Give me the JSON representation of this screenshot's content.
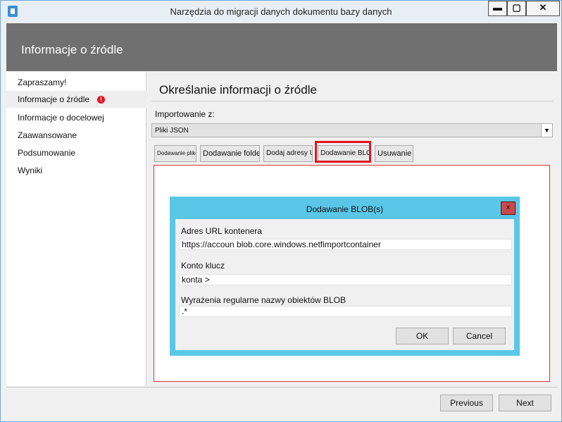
{
  "window": {
    "title": "Narzędzia do migracji danych dokumentu bazy danych",
    "min_label": "▬",
    "max_label": "▢",
    "close_label": "✕"
  },
  "header": {
    "title": "Informacje o źródle"
  },
  "sidebar": {
    "items": [
      {
        "label": "Zapraszamy!"
      },
      {
        "label": "Informacje o źródle",
        "selected": true,
        "warning_icon": "error-icon"
      },
      {
        "label": "Informacje o docelowej"
      },
      {
        "label": "Zaawansowane"
      },
      {
        "label": "Podsumowanie"
      },
      {
        "label": "Wyniki"
      }
    ],
    "warning_glyph": "!"
  },
  "main": {
    "title": "Określanie informacji o źródle",
    "import_label": "Importowanie z:",
    "import_value": "Pliki JSON",
    "dropdown_arrow": "▼",
    "toolbar": {
      "add_files": "Dodawanie plików",
      "add_folder": "Dodawanie folderu",
      "add_urls": "Dodaj adresy URL",
      "add_blob": "Dodawanie BLOB(s)",
      "remove": "Usuwanie"
    }
  },
  "dialog": {
    "title": "Dodawanie BLOB(s)",
    "close_label": "x",
    "url_label": "Adres URL kontenera",
    "url_value": "https://accoun  blob.core.windows.netfimportcontainer",
    "key_label": "Konto klucz",
    "key_value": "konta >",
    "regex_label": "Wyrażenia regularne nazwy obiektów BLOB",
    "regex_value": ".*",
    "ok_label": "OK",
    "cancel_label": "Cancel"
  },
  "footer": {
    "previous_label": "Previous",
    "next_label": "Next"
  },
  "colors": {
    "header_bg": "#707070",
    "dialog_frame": "#5bc7e8",
    "highlight": "#e0161f",
    "error": "#e81123"
  }
}
